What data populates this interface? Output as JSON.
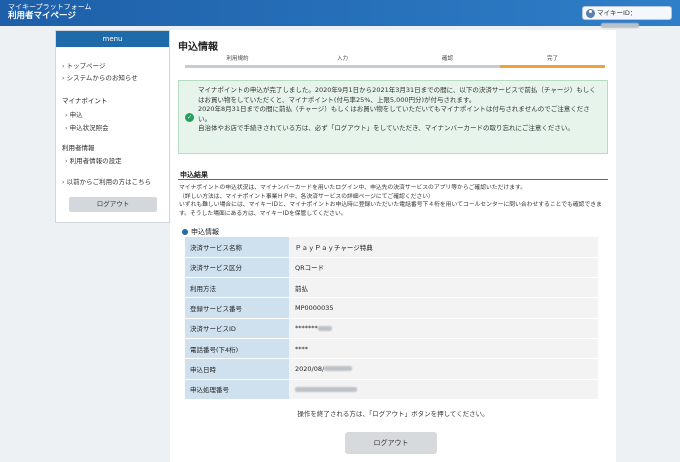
{
  "header": {
    "brand_line1": "マイキープラットフォーム",
    "brand_line2": "利用者マイページ",
    "mykey_label": "マイキーID："
  },
  "sidebar": {
    "title": "menu",
    "items": [
      {
        "label": "トップページ"
      },
      {
        "label": "システムからのお知らせ"
      }
    ],
    "group1_title": "マイナポイント",
    "group1_items": [
      {
        "label": "申込"
      },
      {
        "label": "申込状況照会"
      }
    ],
    "group2_title": "利用者情報",
    "group2_items": [
      {
        "label": "利用者情報の設定"
      }
    ],
    "previous_user": "以前からご利用の方はこちら",
    "logout": "ログアウト"
  },
  "main": {
    "title": "申込情報",
    "steps": [
      "利用規約",
      "入力",
      "確認",
      "完了"
    ],
    "success_lines": [
      "マイナポイントの申込が完了しました。2020年9月1日から2021年3月31日までの間に、以下の決済サービスで前払（チャージ）もしくはお買い物をしていただくと、マイナポイント(付与率25%、上限5,000円分)が付与されます。",
      "2020年8月31日までの間に前払（チャージ）もしくはお買い物をしていただいてもマイナポイントは付与されませんのでご注意ください。",
      "自治体やお店で手続きされている方は、必ず「ログアウト」をしていただき、マイナンバーカードの取り忘れにご注意ください。"
    ],
    "result_title": "申込結果",
    "result_lines": [
      "マイナポイントの申込状況は、マイナンバーカードを用いたログイン中、申込先の決済サービスのアプリ等からご確認いただけます。",
      "（詳しい方法は、マイナポイント事業ＨＰ中、各決済サービスの詳細ページにてご確認ください）",
      "いずれも難しい場合には、マイキーIDと、マイナポイントお申込時に登録いただいた電話番号下４桁を用いてコールセンターに問い合わせすることでも確認できます。そうした場面にある方は、マイキーIDを保管してください。"
    ],
    "info_title": "申込情報",
    "table": [
      {
        "label": "決済サービス名称",
        "value": "ＰａｙＰａｙチャージ特典"
      },
      {
        "label": "決済サービス区分",
        "value": "QRコード"
      },
      {
        "label": "利用方法",
        "value": "前払"
      },
      {
        "label": "登録サービス番号",
        "value": "MP0000035"
      },
      {
        "label": "決済サービスID",
        "value": "*******"
      },
      {
        "label": "電話番号(下4桁)",
        "value": "****"
      },
      {
        "label": "申込日時",
        "value": "2020/08/"
      },
      {
        "label": "申込処理番号",
        "value": ""
      }
    ],
    "end_note": "操作を終了される方は、「ログアウト」ボタンを押してください。",
    "logout_button": "ログアウト"
  }
}
